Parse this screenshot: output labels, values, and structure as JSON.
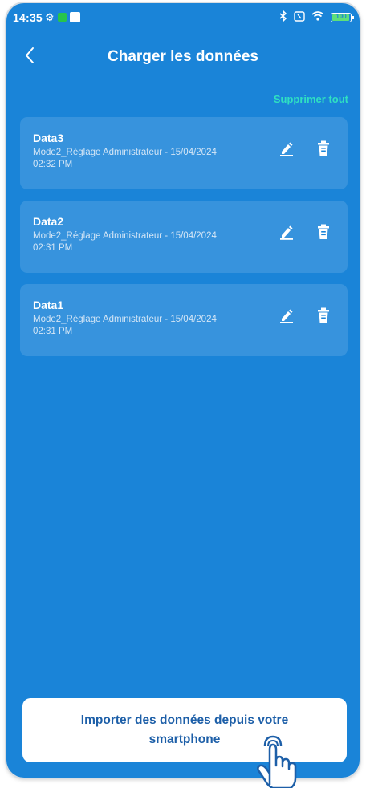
{
  "status_bar": {
    "time": "14:35",
    "battery": "100",
    "icons": [
      "settings-gear-icon",
      "app-notification-icon",
      "message-icon",
      "bluetooth-icon",
      "nfc-icon",
      "wifi-icon",
      "battery-icon"
    ]
  },
  "header": {
    "back_icon": "chevron-left-icon",
    "title": "Charger les données"
  },
  "actions": {
    "delete_all": "Supprimer tout"
  },
  "items": [
    {
      "name": "Data3",
      "description": "Mode2_Réglage Administrateur - 15/04/2024 02:32 PM",
      "edit_icon": "pencil-icon",
      "delete_icon": "trash-icon"
    },
    {
      "name": "Data2",
      "description": "Mode2_Réglage Administrateur - 15/04/2024 02:31 PM",
      "edit_icon": "pencil-icon",
      "delete_icon": "trash-icon"
    },
    {
      "name": "Data1",
      "description": "Mode2_Réglage Administrateur - 15/04/2024 02:31 PM",
      "edit_icon": "pencil-icon",
      "delete_icon": "trash-icon"
    }
  ],
  "footer": {
    "import_label": "Importer des données depuis votre smartphone"
  },
  "colors": {
    "background": "#1a84d8",
    "accent": "#2fe0c2",
    "button_text": "#1d5fa8"
  }
}
